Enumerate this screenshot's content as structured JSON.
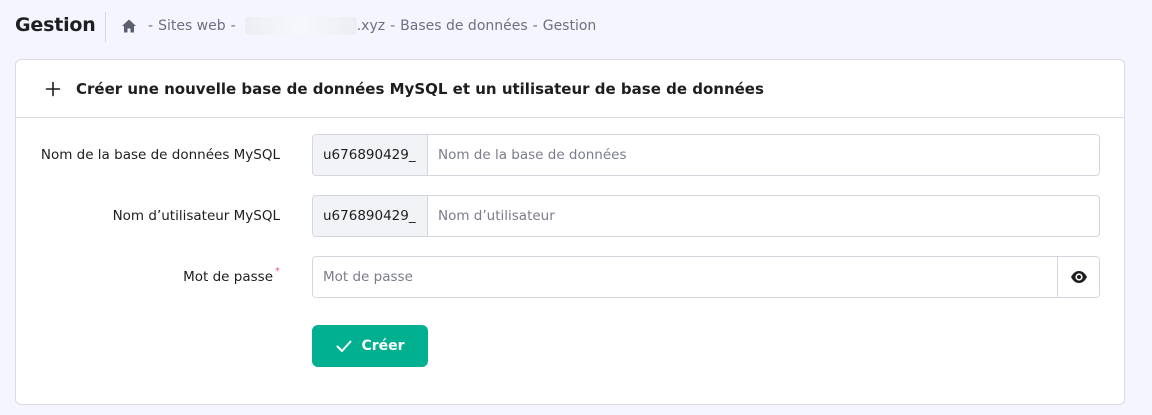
{
  "header": {
    "title": "Gestion",
    "breadcrumb": [
      {
        "label": "Sites web"
      },
      {
        "label": ".xyz"
      },
      {
        "label": "Bases de données"
      },
      {
        "label": "Gestion"
      }
    ],
    "separator": "-"
  },
  "card": {
    "title": "Créer une nouvelle base de données MySQL et un utilisateur de base de données",
    "fields": {
      "db_name": {
        "label": "Nom de la base de données MySQL",
        "prefix": "u676890429_",
        "value": "",
        "placeholder": "Nom de la base de données"
      },
      "username": {
        "label": "Nom d’utilisateur MySQL",
        "prefix": "u676890429_",
        "value": "",
        "placeholder": "Nom d’utilisateur"
      },
      "password": {
        "label": "Mot de passe",
        "required_mark": "*",
        "value": "",
        "placeholder": "Mot de passe",
        "toggle_icon": "eye-icon"
      }
    },
    "submit": {
      "label": "Créer",
      "icon": "check-icon"
    }
  },
  "colors": {
    "accent": "#00b090",
    "required": "#fc5185",
    "text": "#1d1e20",
    "muted": "#6d7081",
    "background": "#f4f5ff"
  }
}
